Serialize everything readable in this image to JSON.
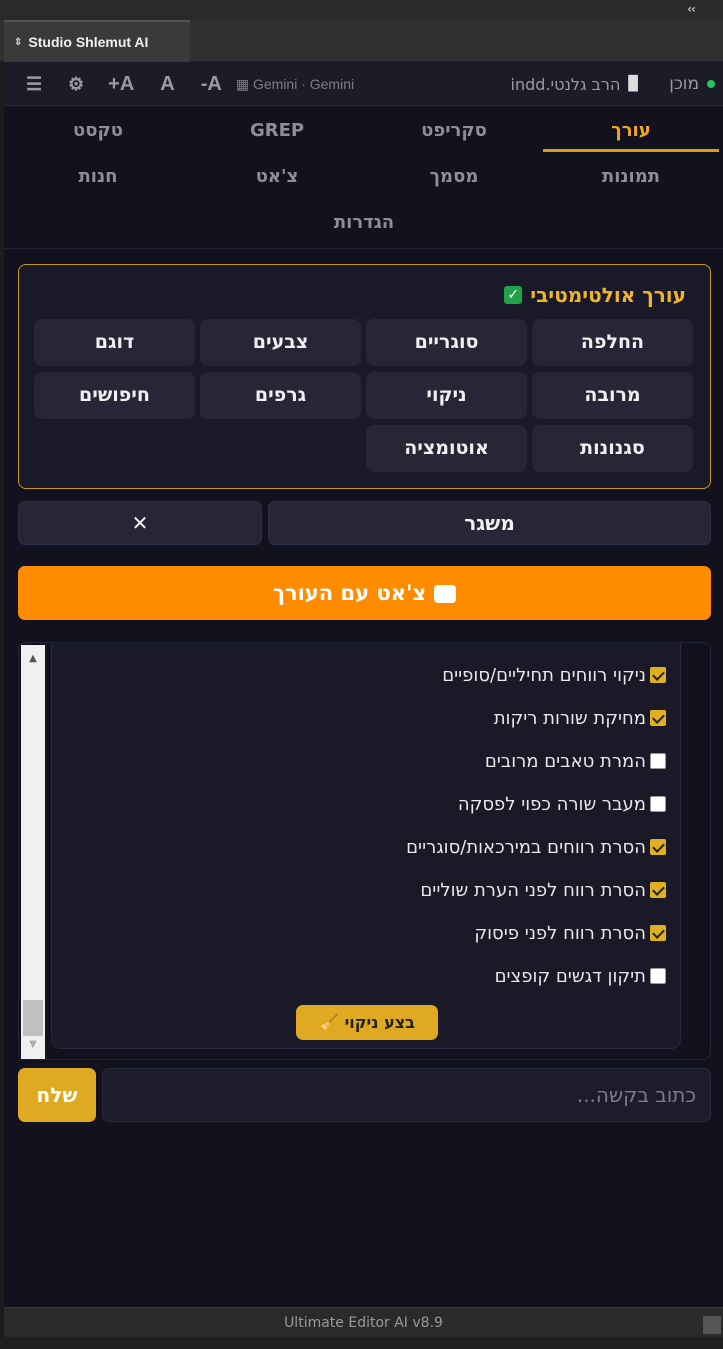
{
  "window": {
    "collapse_glyph": "‹‹",
    "panel_tab_arrows": "⇕",
    "panel_tab_title": "Studio Shlemut AI"
  },
  "header": {
    "menu_glyph": "☰",
    "gear_glyph": "⚙",
    "font_increase": "+A",
    "font_reset": "A",
    "font_decrease": "-A",
    "model_label": "Gemini · Gemini",
    "status_text": "מוכן",
    "status_color": "#22c55e",
    "doc_name": "הרב גלנטי.indd"
  },
  "nav": {
    "tabs": [
      {
        "label": "עורך",
        "active": true
      },
      {
        "label": "סקריפט"
      },
      {
        "label": "GREP"
      },
      {
        "label": "טקסט"
      },
      {
        "label": "תמונות"
      },
      {
        "label": "מסמך"
      },
      {
        "label": "צ'אט"
      },
      {
        "label": "חנות"
      },
      {
        "label": "הגדרות"
      }
    ]
  },
  "editor": {
    "title": "עורך אולטימטיבי",
    "title_checkbox": "✓",
    "buttons": [
      "החלפה",
      "סוגריים",
      "צבעים",
      "דוגם",
      "מרובה",
      "ניקוי",
      "גרפים",
      "חיפושים",
      "סגנונות",
      "אוטומציה"
    ]
  },
  "actions": {
    "launch_label": "משגר",
    "close_label": "✕",
    "chat_label": "צ'אט עם העורך"
  },
  "cleanup": {
    "options": [
      {
        "label": "ניקוי רווחים תחיליים/סופיים",
        "checked": true
      },
      {
        "label": "מחיקת שורות ריקות",
        "checked": true
      },
      {
        "label": "המרת טאבים מרובים",
        "checked": false
      },
      {
        "label": "מעבר שורה כפוי לפסקה",
        "checked": false
      },
      {
        "label": "הסרת רווחים במירכאות/סוגריים",
        "checked": true
      },
      {
        "label": "הסרת רווח לפני הערת שוליים",
        "checked": true
      },
      {
        "label": "הסרת רווח לפני פיסוק",
        "checked": true
      },
      {
        "label": "תיקון דגשים קופצים",
        "checked": false
      }
    ],
    "run_label": "בצע ניקוי",
    "run_icon": "🧹"
  },
  "input": {
    "placeholder": "כתוב בקשה...",
    "send_label": "שלח"
  },
  "footer": {
    "version": "Ultimate Editor AI v8.9"
  }
}
